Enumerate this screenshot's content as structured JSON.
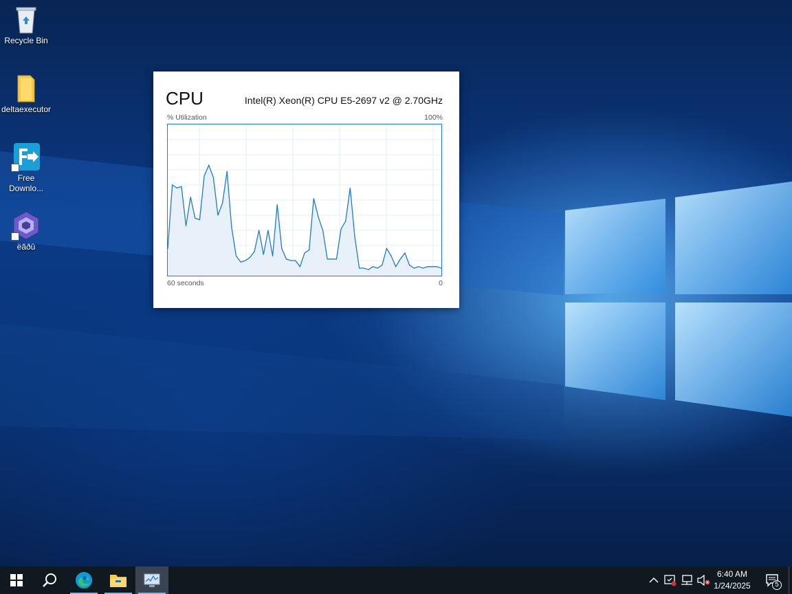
{
  "desktop": {
    "icons": [
      {
        "label": "Recycle Bin",
        "icon": "recycle-bin-icon"
      },
      {
        "label": "deltaexecutor",
        "icon": "folder-icon"
      },
      {
        "label": "Free Downlo...",
        "icon": "free-download-manager-icon"
      },
      {
        "label": "ëãðû",
        "icon": "gamecube-icon"
      }
    ]
  },
  "cpu_widget": {
    "title": "CPU",
    "model": "Intel(R) Xeon(R) CPU E5-2697 v2 @ 2.70GHz",
    "y_label": "% Utilization",
    "y_max_label": "100%",
    "x_start_label": "60 seconds",
    "x_end_label": "0",
    "line_color": "#1f7cc0",
    "fill_color": "#e8f1fa"
  },
  "chart_data": {
    "type": "line",
    "title": "CPU",
    "ylabel": "% Utilization",
    "xlabel": "",
    "x_range_label": [
      "60 seconds",
      "0"
    ],
    "ylim": [
      0,
      100
    ],
    "x": [
      60,
      59,
      58,
      57,
      56,
      55,
      54,
      53,
      52,
      51,
      50,
      49,
      48,
      47,
      46,
      45,
      44,
      43,
      42,
      41,
      40,
      39,
      38,
      37,
      36,
      35,
      34,
      33,
      32,
      31,
      30,
      29,
      28,
      27,
      26,
      25,
      24,
      23,
      22,
      21,
      20,
      19,
      18,
      17,
      16,
      15,
      14,
      13,
      12,
      11,
      10,
      9,
      8,
      7,
      6,
      5,
      4,
      3,
      2,
      1,
      0
    ],
    "values": [
      18,
      60,
      58,
      59,
      33,
      52,
      38,
      37,
      66,
      73,
      65,
      40,
      48,
      69,
      32,
      13,
      9,
      10,
      12,
      16,
      30,
      14,
      30,
      13,
      47,
      18,
      11,
      10,
      10,
      6,
      15,
      17,
      51,
      39,
      30,
      11,
      11,
      11,
      31,
      36,
      58,
      26,
      5,
      5,
      4,
      6,
      5,
      7,
      18,
      13,
      6,
      11,
      15,
      7,
      5,
      6,
      5,
      6,
      6,
      6,
      5
    ],
    "grid": true
  },
  "taskbar": {
    "items": [
      {
        "name": "start",
        "icon": "windows-logo-icon"
      },
      {
        "name": "search",
        "icon": "search-icon"
      },
      {
        "name": "edge",
        "icon": "edge-icon"
      },
      {
        "name": "file-explorer",
        "icon": "folder-icon"
      },
      {
        "name": "task-manager",
        "icon": "task-manager-icon"
      }
    ],
    "tray": {
      "chevron": "chevron-up-icon",
      "icons": [
        "security-alert-icon",
        "network-icon",
        "volume-muted-icon"
      ]
    },
    "clock": {
      "time": "6:40 AM",
      "date": "1/24/2025"
    },
    "notifications_count": "5"
  }
}
